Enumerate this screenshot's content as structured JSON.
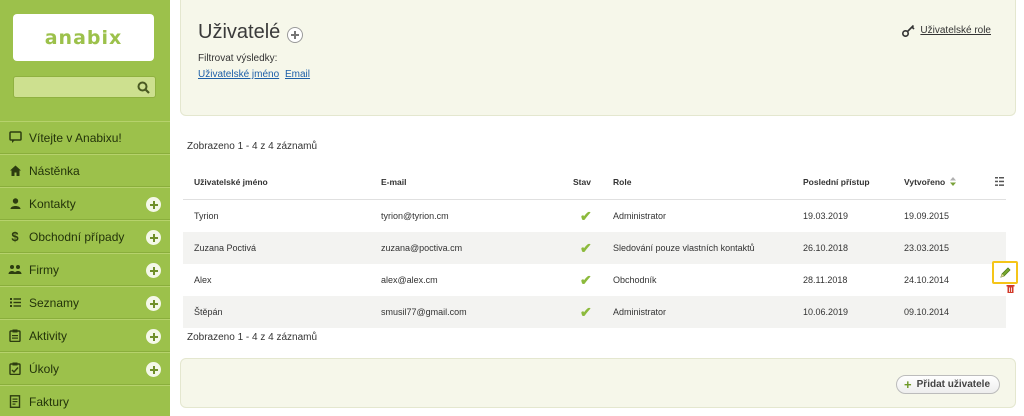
{
  "brand": {
    "logo_text": "anabix"
  },
  "search": {
    "placeholder": ""
  },
  "sidebar": {
    "items": [
      {
        "label": "Vítejte v Anabixu!",
        "icon": "chat-icon",
        "plus": false
      },
      {
        "label": "Nástěnka",
        "icon": "home-icon",
        "plus": false
      },
      {
        "label": "Kontakty",
        "icon": "person-icon",
        "plus": true
      },
      {
        "label": "Obchodní případy",
        "icon": "dollar-icon",
        "plus": true
      },
      {
        "label": "Firmy",
        "icon": "group-icon",
        "plus": true
      },
      {
        "label": "Seznamy",
        "icon": "list-icon",
        "plus": true
      },
      {
        "label": "Aktivity",
        "icon": "clipboard-icon",
        "plus": true
      },
      {
        "label": "Úkoly",
        "icon": "checklist-icon",
        "plus": true
      },
      {
        "label": "Faktury",
        "icon": "invoice-icon",
        "plus": false
      }
    ]
  },
  "header": {
    "title": "Uživatelé",
    "filter_label": "Filtrovat výsledky:",
    "filters": [
      "Uživatelské jméno",
      "Email"
    ],
    "role_link": "Uživatelské role"
  },
  "summary": {
    "top": "Zobrazeno 1 - 4 z 4 záznamů",
    "bottom": "Zobrazeno 1 - 4 z 4 záznamů"
  },
  "table": {
    "columns": [
      "Uživatelské jméno",
      "E-mail",
      "Stav",
      "Role",
      "Poslední přístup",
      "Vytvořeno"
    ],
    "rows": [
      {
        "name": "Tyrion",
        "email": "tyrion@tyrion.cm",
        "role": "Administrator",
        "last": "19.03.2019",
        "created": "19.09.2015"
      },
      {
        "name": "Zuzana Poctivá",
        "email": "zuzana@poctiva.cm",
        "role": "Sledování pouze vlastních kontaktů",
        "last": "26.10.2018",
        "created": "23.03.2015"
      },
      {
        "name": "Alex",
        "email": "alex@alex.cm",
        "role": "Obchodník",
        "last": "28.11.2018",
        "created": "24.10.2014"
      },
      {
        "name": "Štěpán",
        "email": "smusil77@gmail.com",
        "role": "Administrator",
        "last": "10.06.2019",
        "created": "09.10.2014"
      }
    ]
  },
  "actions": {
    "add_user": "Přidat uživatele"
  },
  "colors": {
    "sidebar_bg": "#9cc14b",
    "accent_green": "#8cba3c",
    "link_blue": "#1d5fa8",
    "highlight": "#f5c518"
  }
}
